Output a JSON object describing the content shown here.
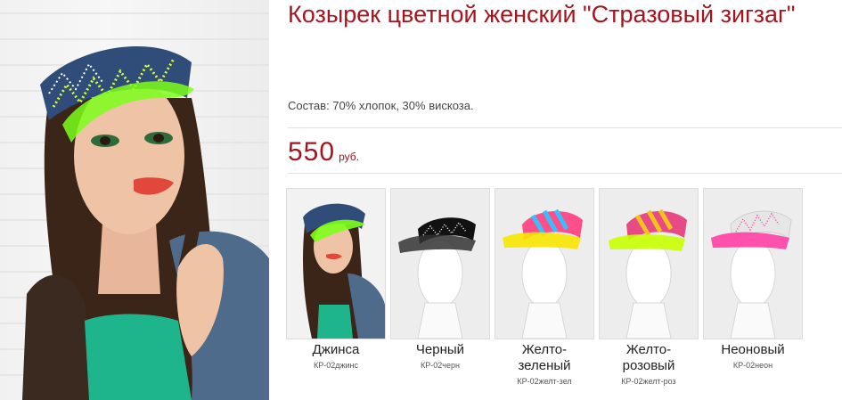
{
  "product": {
    "title": "Козырек цветной женский \"Стразовый зигзаг\"",
    "composition": "Состав: 70% хлопок, 30% вискоза.",
    "price": "550",
    "currency": "руб."
  },
  "variants": [
    {
      "name": "Джинса",
      "code": "КР-02джинс",
      "color": "#2a4a7a",
      "visor": "#7dff1a"
    },
    {
      "name": "Черный",
      "code": "КР-02черн",
      "color": "#1a1a1a",
      "visor": "#333333"
    },
    {
      "name": "Желто-\nзеленый",
      "code": "КР-02желт-зел",
      "color": "#f4c21c",
      "visor": "#f7e600"
    },
    {
      "name": "Желто-\nрозовый",
      "code": "КР-02желт-роз",
      "color": "#e84a86",
      "visor": "#c6ff00"
    },
    {
      "name": "Неоновый",
      "code": "КР-02неон",
      "color": "#e6e6e6",
      "visor": "#ff3ea5"
    }
  ],
  "colors": {
    "accent": "#a8141d"
  }
}
